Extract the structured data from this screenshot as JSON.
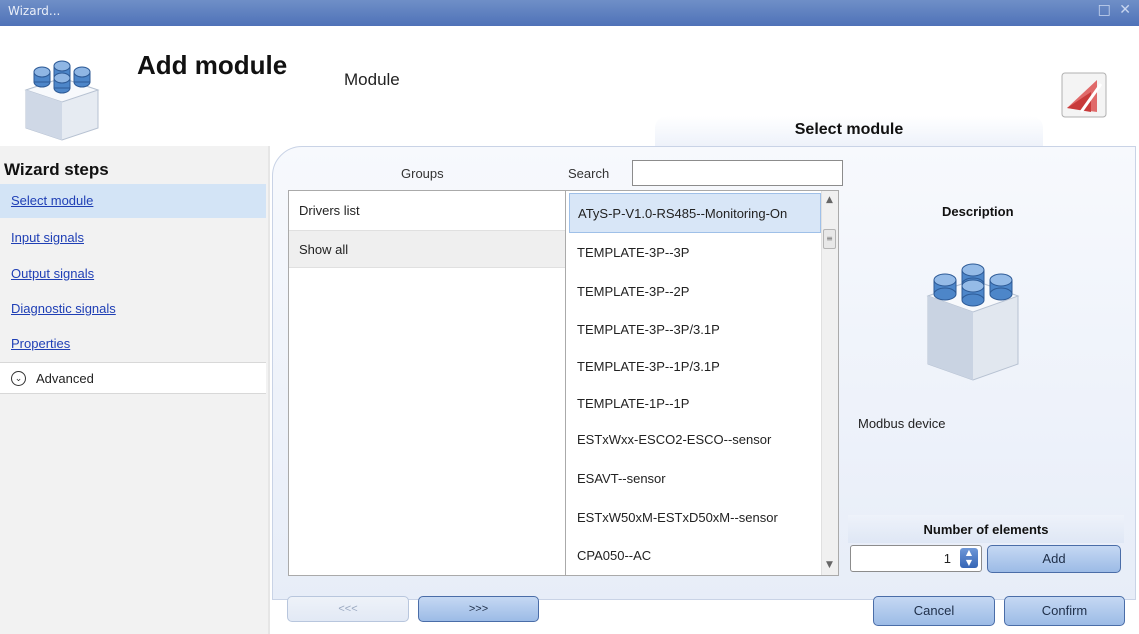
{
  "window": {
    "title": "Wizard...",
    "controls": "□ ✕"
  },
  "header": {
    "title": "Add module",
    "subtitle": "Module",
    "section_tab": "Select module"
  },
  "sidebar": {
    "title": "Wizard steps",
    "steps": [
      {
        "label": "Select module"
      },
      {
        "label": "Input signals"
      },
      {
        "label": "Output signals"
      },
      {
        "label": "Diagnostic signals"
      },
      {
        "label": "Properties"
      }
    ],
    "advanced_label": "Advanced"
  },
  "groups": {
    "header": "Groups",
    "items": [
      {
        "label": "Drivers list"
      },
      {
        "label": "Show all"
      }
    ],
    "selected": "Show all"
  },
  "search": {
    "label": "Search",
    "value": ""
  },
  "modules": {
    "items": [
      {
        "label": "ATyS-P-V1.0-RS485--Monitoring-On"
      },
      {
        "label": "TEMPLATE-3P--3P"
      },
      {
        "label": "TEMPLATE-3P--2P"
      },
      {
        "label": "TEMPLATE-3P--3P/3.1P"
      },
      {
        "label": "TEMPLATE-3P--1P/3.1P"
      },
      {
        "label": "TEMPLATE-1P--1P"
      },
      {
        "label": "ESTxWxx-ESCO2-ESCO--sensor"
      },
      {
        "label": "ESAVT--sensor"
      },
      {
        "label": "ESTxW50xM-ESTxD50xM--sensor"
      },
      {
        "label": "CPA050--AC"
      }
    ],
    "selected": "ATyS-P-V1.0-RS485--Monitoring-On"
  },
  "description": {
    "title": "Description",
    "text": "Modbus device"
  },
  "number_of_elements": {
    "label": "Number of elements",
    "value": "1",
    "add_label": "Add"
  },
  "nav": {
    "prev_label": "<<<",
    "next_label": ">>>"
  },
  "footer": {
    "cancel_label": "Cancel",
    "confirm_label": "Confirm"
  },
  "colors": {
    "accent": "#4f72b8",
    "link": "#1f3fb5",
    "selection": "#d8e6f7"
  }
}
